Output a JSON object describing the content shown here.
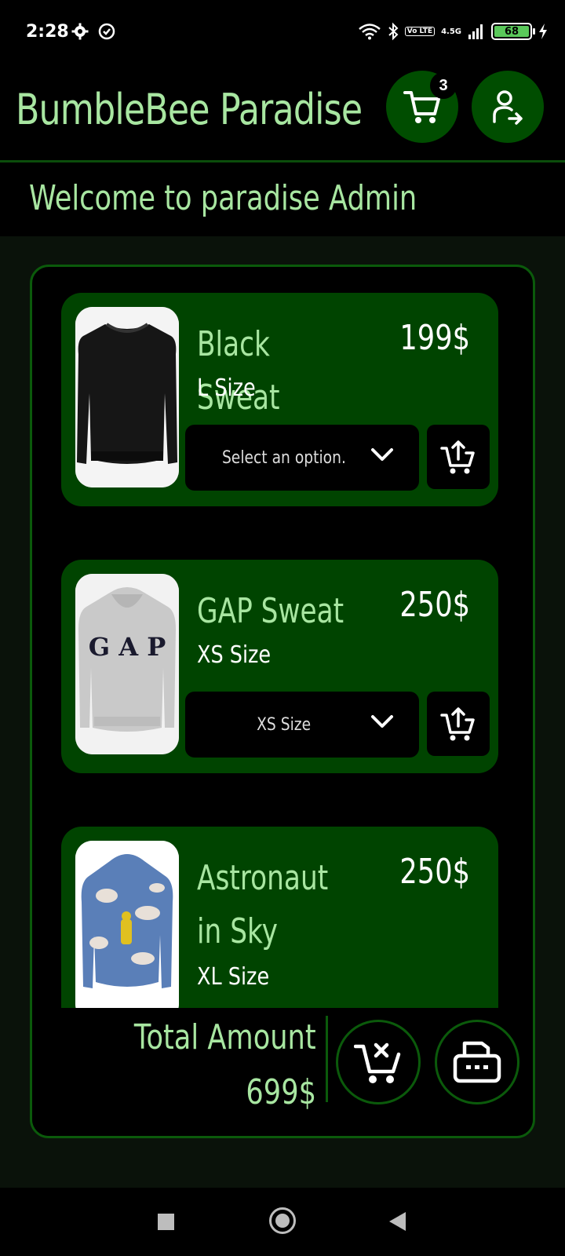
{
  "status_bar": {
    "time": "2:28",
    "network": "4.5G",
    "volte": "Vo LTE",
    "battery": "68"
  },
  "header": {
    "title": "BumbleBee Paradise",
    "cart_count": "3"
  },
  "welcome": "Welcome to paradise Admin",
  "products": [
    {
      "name": "Black Sweat",
      "price": "199$",
      "size": "L Size",
      "select_value": "Select an option."
    },
    {
      "name": "GAP Sweat",
      "price": "250$",
      "size": "XS Size",
      "select_value": "XS Size",
      "image_text": "GAP"
    },
    {
      "name": "Astronaut in Sky",
      "price": "250$",
      "size": "XL Size"
    }
  ],
  "footer": {
    "total_label": "Total Amount",
    "total_value": "699$"
  },
  "colors": {
    "accent_green": "#a8e6a1",
    "card_green": "#004400",
    "button_green": "#004d00",
    "background": "#000000"
  }
}
